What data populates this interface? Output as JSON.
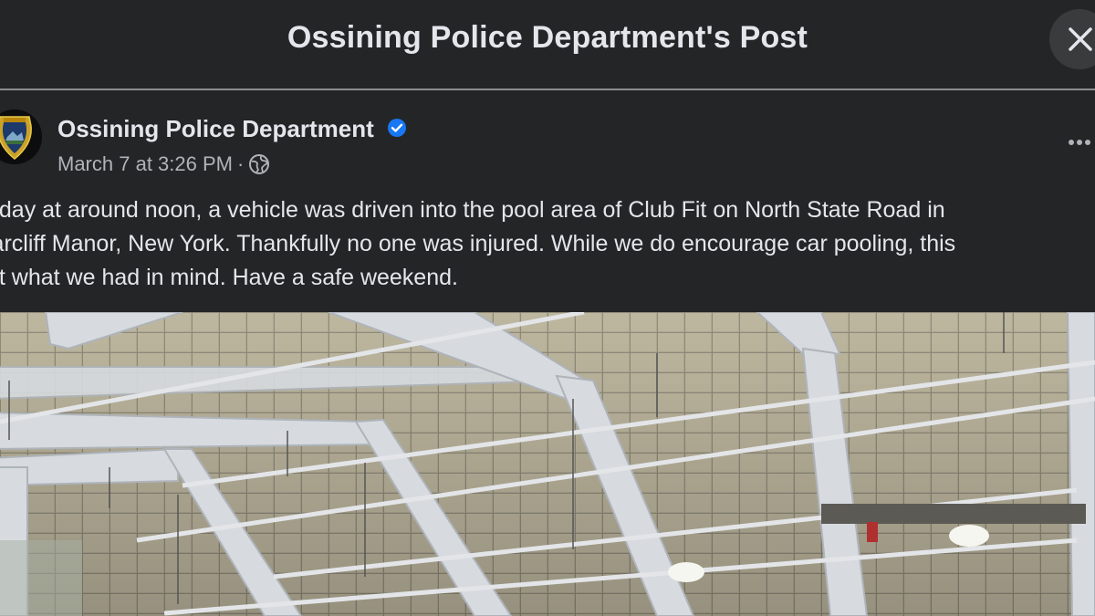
{
  "header": {
    "title": "Ossining Police Department's Post"
  },
  "post": {
    "author": "Ossining Police Department",
    "verified": true,
    "timestamp": "March 7 at 3:26 PM",
    "separator": "·",
    "audience_icon": "globe-icon",
    "text_lines": [
      "oday at around noon, a vehicle was driven into the pool area of Club Fit on North State Road in",
      "iarcliff Manor, New York.  Thankfully no one was injured.  While we do encourage car pooling, this",
      "ot what we had in mind.  Have a safe weekend."
    ],
    "photo_alt": "Interior of indoor pool building roof with steel trusses"
  },
  "colors": {
    "background": "#242526",
    "text_primary": "#e4e6eb",
    "text_secondary": "#b0b3b8",
    "verified_badge": "#1877f2",
    "close_button_bg": "#3a3b3c"
  }
}
